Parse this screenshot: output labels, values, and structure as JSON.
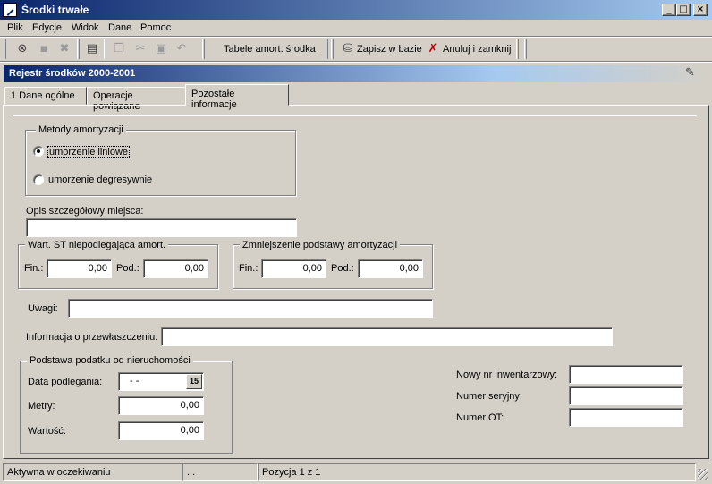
{
  "window": {
    "title": "Środki trwałe",
    "minimize": "_",
    "maximize": "□",
    "close": "×"
  },
  "menu": [
    "Plik",
    "Edycje",
    "Widok",
    "Dane",
    "Pomoc"
  ],
  "toolbar": {
    "tabele_label": "Tabele amort. środka",
    "zapisz_label": "Zapisz w bazie",
    "anuluj_label": "Anuluj i zamknij",
    "icons": [
      "close-document-icon",
      "save-disk-icon",
      "delete-icon",
      "properties-icon",
      "copy-icon",
      "cut-icon",
      "paste-icon",
      "undo-icon"
    ]
  },
  "header": {
    "text": "Rejestr środków 2000-2001"
  },
  "tabs": [
    "1 Dane ogólne",
    "Operacje powiązane",
    "Pozostałe informacje"
  ],
  "metody": {
    "legend": "Metody amortyzacji",
    "options": [
      "umorzenie liniowe",
      "umorzenie degresywnie"
    ],
    "selected": "umorzenie liniowe"
  },
  "opis": {
    "label": "Opis szczegółowy miejsca:",
    "value": ""
  },
  "wart_st": {
    "legend": "Wart. ST niepodlegająca amort.",
    "fin_label": "Fin.:",
    "fin_value": "0,00",
    "pod_label": "Pod.:",
    "pod_value": "0,00"
  },
  "zmniejszenie": {
    "legend": "Zmniejszenie podstawy amortyzacji",
    "fin_label": "Fin.:",
    "fin_value": "0,00",
    "pod_label": "Pod.:",
    "pod_value": "0,00"
  },
  "uwagi": {
    "label": "Uwagi:",
    "value": ""
  },
  "przewlaszczenie": {
    "label": "Informacja o przewłaszczeniu:",
    "value": ""
  },
  "podatek": {
    "legend": "Podstawa podatku od nieruchomości",
    "data_label": "Data podlegania:",
    "data_value": "  -  -",
    "cal_label": "15",
    "metry_label": "Metry:",
    "metry_value": "0,00",
    "wartosc_label": "Wartość:",
    "wartosc_value": "0,00"
  },
  "right": {
    "inwentarzowy_label": "Nowy nr inwentarzowy:",
    "inwentarzowy_value": "",
    "seryjny_label": "Numer seryjny:",
    "seryjny_value": "",
    "ot_label": "Numer OT:",
    "ot_value": ""
  },
  "status": {
    "state": "Aktywna w oczekiwaniu",
    "dots": "...",
    "position": "Pozycja 1 z 1"
  }
}
